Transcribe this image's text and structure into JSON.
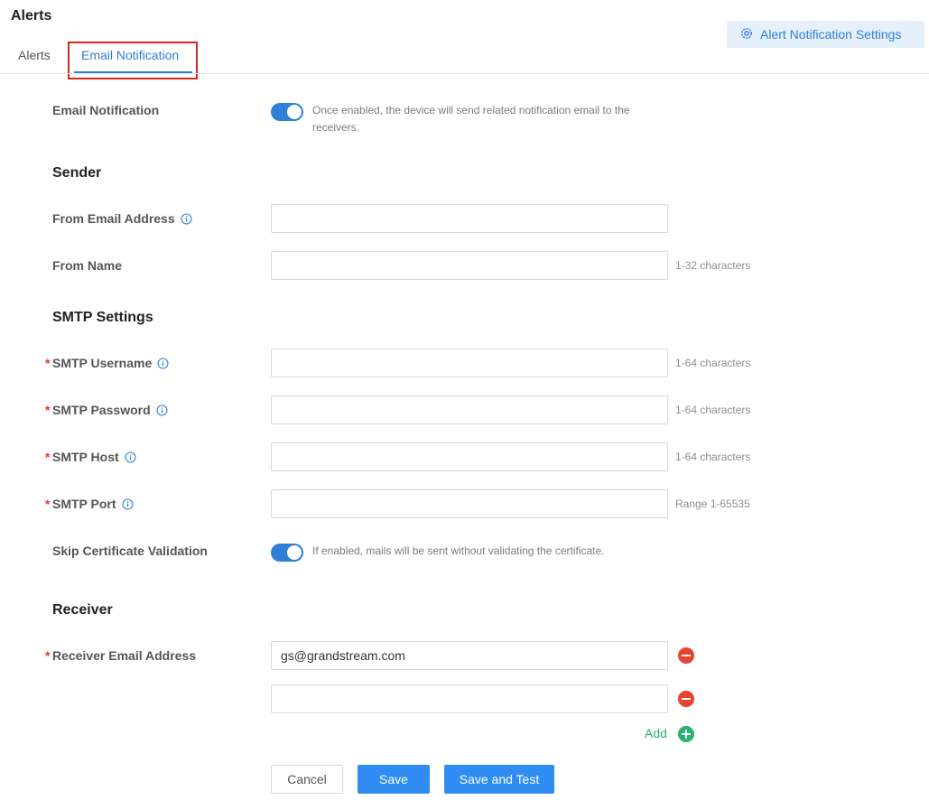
{
  "page": {
    "title": "Alerts"
  },
  "tabs": [
    {
      "label": "Alerts"
    },
    {
      "label": "Email Notification"
    }
  ],
  "header": {
    "settings_button": "Alert Notification Settings"
  },
  "email_notification": {
    "label": "Email Notification",
    "enabled": true,
    "description_line1": "Once enabled, the device will send related notification email to the",
    "description_line2": "receivers."
  },
  "sender": {
    "title": "Sender",
    "from_email": {
      "label": "From Email Address",
      "value": ""
    },
    "from_name": {
      "label": "From Name",
      "value": "",
      "hint": "1-32 characters"
    }
  },
  "smtp": {
    "title": "SMTP Settings",
    "username": {
      "label": "SMTP Username",
      "value": "",
      "hint": "1-64 characters"
    },
    "password": {
      "label": "SMTP Password",
      "value": "",
      "hint": "1-64 characters"
    },
    "host": {
      "label": "SMTP Host",
      "value": "",
      "hint": "1-64 characters"
    },
    "port": {
      "label": "SMTP Port",
      "value": "",
      "hint": "Range 1-65535"
    },
    "skip_cert": {
      "label": "Skip Certificate Validation",
      "enabled": true,
      "description": "If enabled, mails will be sent without validating the certificate."
    }
  },
  "receiver": {
    "title": "Receiver",
    "label": "Receiver Email Address",
    "emails": [
      "gs@grandstream.com",
      ""
    ],
    "add_label": "Add"
  },
  "actions": {
    "cancel": "Cancel",
    "save": "Save",
    "save_test": "Save and Test"
  },
  "required_mark": "*",
  "colors": {
    "accent": "#2f7fd8",
    "danger": "#e8432f",
    "success": "#27b36a",
    "highlight": "#d9261c"
  }
}
